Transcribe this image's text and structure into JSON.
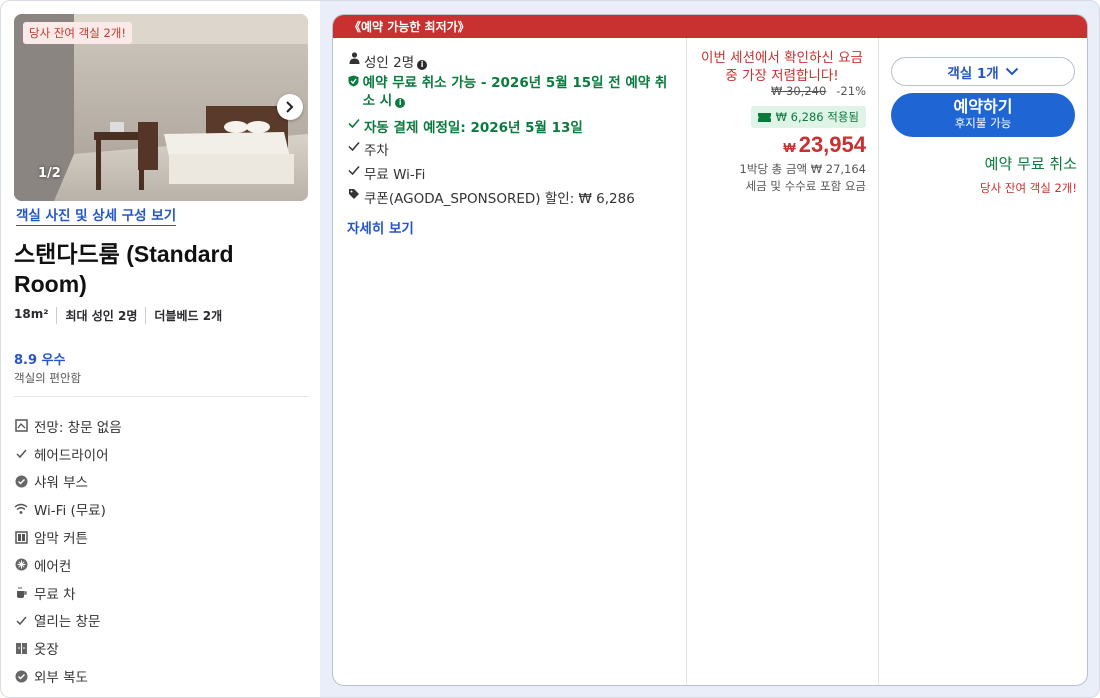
{
  "colors": {
    "accent_red": "#c8312f",
    "link_blue": "#2456c7",
    "button_blue": "#1f66d4",
    "success_green": "#0b7a3d"
  },
  "room": {
    "photo_badge": "당사 잔여 객실 2개!",
    "photo_counter": "1/2",
    "photo_link": "객실 사진 및 상세 구성 보기",
    "title": "스탠다드룸 (Standard Room)",
    "specs": [
      "18m²",
      "최대 성인 2명",
      "더블베드 2개"
    ],
    "rating_score": "8.9 우수",
    "rating_label": "객실의 편안함",
    "amenities": [
      {
        "icon": "view-icon",
        "label": "전망: 창문 없음"
      },
      {
        "icon": "check-icon",
        "label": "헤어드라이어"
      },
      {
        "icon": "shower-icon",
        "label": "샤워 부스"
      },
      {
        "icon": "wifi-icon",
        "label": "Wi-Fi (무료)"
      },
      {
        "icon": "blackout-curtain-icon",
        "label": "암막 커튼"
      },
      {
        "icon": "air-conditioner-icon",
        "label": "에어컨"
      },
      {
        "icon": "tea-icon",
        "label": "무료 차"
      },
      {
        "icon": "check-icon",
        "label": "열리는 창문"
      },
      {
        "icon": "wardrobe-icon",
        "label": "옷장"
      },
      {
        "icon": "corridor-icon",
        "label": "외부 복도"
      }
    ]
  },
  "offer": {
    "banner": "《예약 가능한 최저가》",
    "features": {
      "guests": "성인 2명",
      "free_cancel": "예약 무료 취소 가능 - 2026년 5월 15일 전 예약 취소 시",
      "auto_payment": "자동 결제 예정일: 2026년 5월 13일",
      "parking": "주차",
      "wifi": "무료 Wi-Fi",
      "coupon": "쿠폰(AGODA_SPONSORED) 할인: ₩ 6,286"
    },
    "more_link": "자세히 보기",
    "price": {
      "promo": "이번 세션에서 확인하신 요금 중 가장 저렴합니다!",
      "original": "₩ 30,240",
      "discount": "-21%",
      "coupon_applied": "₩ 6,286 적용됨",
      "currency": "₩",
      "amount": "23,954",
      "total_per_night": "1박당 총 금액 ₩ 27,164",
      "tax_note": "세금 및 수수료 포함 요금"
    },
    "booking": {
      "room_select": "객실 1개",
      "book_label": "예약하기",
      "book_sub": "후지불 가능",
      "free_cancel": "예약 무료 취소",
      "rooms_left": "당사 잔여 객실 2개!"
    }
  }
}
